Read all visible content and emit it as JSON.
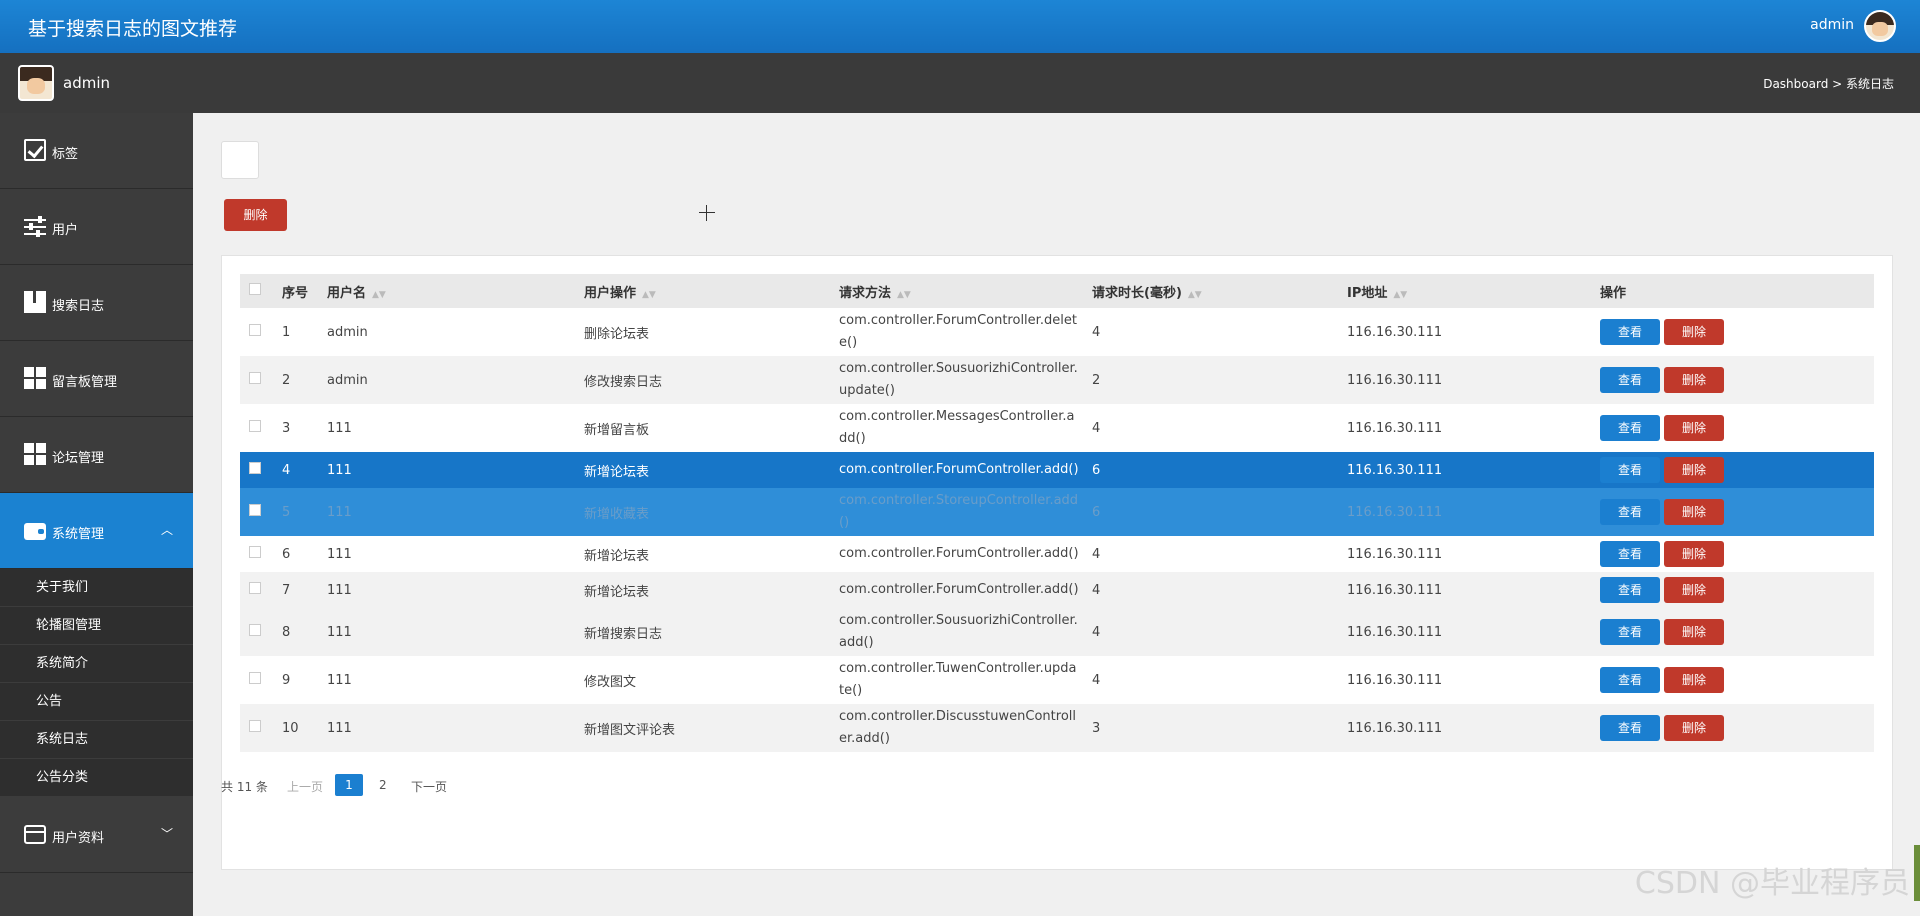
{
  "header": {
    "title": "基于搜索日志的图文推荐",
    "user": "admin"
  },
  "subbar": {
    "name": "admin",
    "breadcrumb": "Dashboard > 系统日志"
  },
  "sidebar": {
    "items": [
      {
        "label": "标签",
        "icon": "checklist-icon"
      },
      {
        "label": "用户",
        "icon": "sliders-icon"
      },
      {
        "label": "搜索日志",
        "icon": "book-icon"
      },
      {
        "label": "留言板管理",
        "icon": "grid-icon"
      },
      {
        "label": "论坛管理",
        "icon": "grid-icon"
      },
      {
        "label": "系统管理",
        "icon": "wallet-icon",
        "active": true
      },
      {
        "label": "用户资料",
        "icon": "card-icon"
      }
    ],
    "submenu": [
      "关于我们",
      "轮播图管理",
      "系统简介",
      "公告",
      "系统日志",
      "公告分类"
    ]
  },
  "toolbar": {
    "delete_label": "删除"
  },
  "table": {
    "headers": [
      "序号",
      "用户名",
      "用户操作",
      "请求方法",
      "请求时长(毫秒)",
      "IP地址",
      "操作"
    ],
    "view_label": "查看",
    "delete_label": "删除",
    "rows": [
      [
        "1",
        "admin",
        "删除论坛表",
        "com.controller.ForumController.delete()",
        "4",
        "116.16.30.111"
      ],
      [
        "2",
        "admin",
        "修改搜索日志",
        "com.controller.SousuorizhiController.update()",
        "2",
        "116.16.30.111"
      ],
      [
        "3",
        "111",
        "新增留言板",
        "com.controller.MessagesController.add()",
        "4",
        "116.16.30.111"
      ],
      [
        "4",
        "111",
        "新增论坛表",
        "com.controller.ForumController.add()",
        "6",
        "116.16.30.111"
      ],
      [
        "5",
        "111",
        "新增收藏表",
        "com.controller.StoreupController.add()",
        "6",
        "116.16.30.111"
      ],
      [
        "6",
        "111",
        "新增论坛表",
        "com.controller.ForumController.add()",
        "4",
        "116.16.30.111"
      ],
      [
        "7",
        "111",
        "新增论坛表",
        "com.controller.ForumController.add()",
        "4",
        "116.16.30.111"
      ],
      [
        "8",
        "111",
        "新增搜索日志",
        "com.controller.SousuorizhiController.add()",
        "4",
        "116.16.30.111"
      ],
      [
        "9",
        "111",
        "修改图文",
        "com.controller.TuwenController.update()",
        "4",
        "116.16.30.111"
      ],
      [
        "10",
        "111",
        "新增图文评论表",
        "com.controller.DiscusstuwenController.add()",
        "3",
        "116.16.30.111"
      ]
    ]
  },
  "pagination": {
    "total": "共 11 条",
    "prev": "上一页",
    "pages": [
      "1",
      "2"
    ],
    "current": "1",
    "next": "下一页"
  },
  "watermark": "CSDN @毕业程序员",
  "colors": {
    "primary": "#1b7fd0",
    "danger": "#c0392b",
    "sidebar": "#3c3c3c"
  }
}
